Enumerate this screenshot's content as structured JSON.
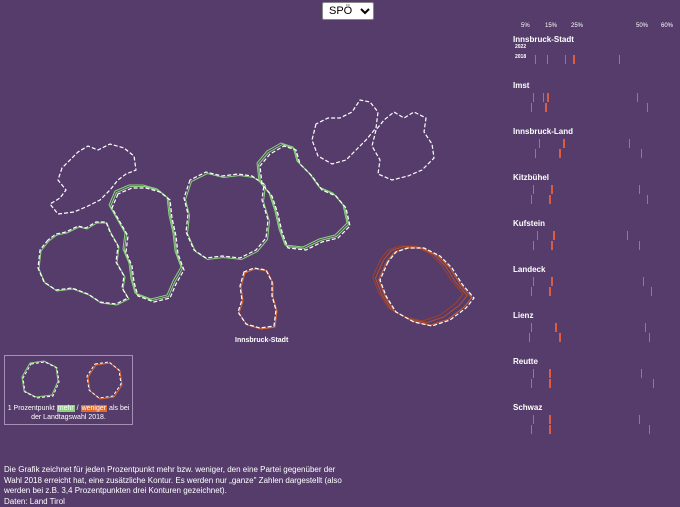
{
  "party_select": {
    "selected": "SPÖ"
  },
  "map_label": "Innsbruck-Stadt",
  "legend": {
    "text_prefix": "1 Prozentpunkt",
    "more": "mehr",
    "separator": "/",
    "less": "weniger",
    "text_suffix": "als bei der Landtagswahl 2018."
  },
  "footer": {
    "line1": "Die Grafik zeichnet für jeden Prozentpunkt mehr bzw. weniger, den eine Partei gegenüber der Wahl 2018 erreicht hat, eine zusätzliche Kontur. Es werden nur „ganze\"   Zahlen dargestellt (also werden bei z.B. 3,4 Prozentpunkten drei Konturen gezeichnet).",
    "source": "Daten: Land Tirol"
  },
  "axis_ticks": [
    "5%",
    "15%",
    "25%",
    "50%",
    "60%"
  ],
  "year_labels": [
    "2022",
    "2018"
  ],
  "regions": [
    {
      "name": "Innsbruck-Stadt",
      "show_years": true
    },
    {
      "name": "Imst"
    },
    {
      "name": "Innsbruck-Land"
    },
    {
      "name": "Kitzbühel"
    },
    {
      "name": "Kufstein"
    },
    {
      "name": "Landeck"
    },
    {
      "name": "Lienz"
    },
    {
      "name": "Reutte"
    },
    {
      "name": "Schwaz"
    }
  ],
  "colors": {
    "more": "#8cd37d",
    "less": "#e06a2c",
    "background": "#553c6a"
  }
}
